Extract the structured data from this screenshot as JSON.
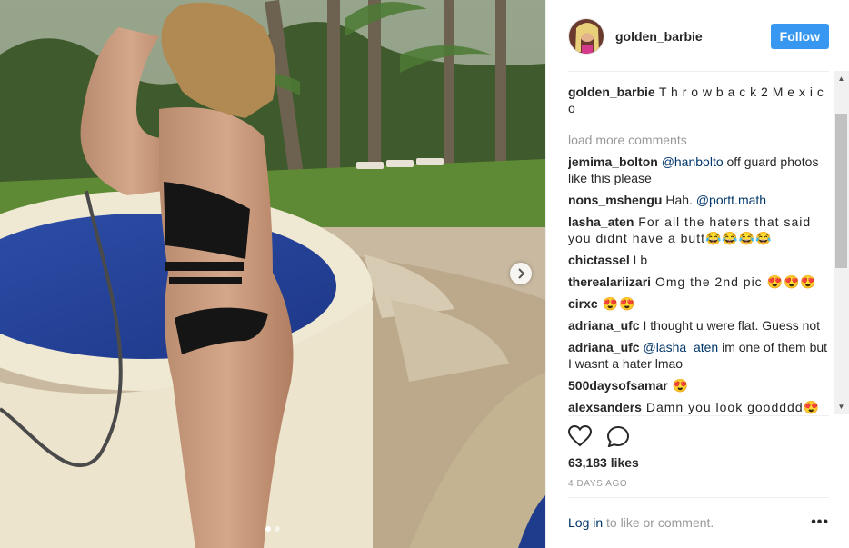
{
  "post": {
    "username": "golden_barbie",
    "follow_label": "Follow",
    "caption_user": "golden_barbie",
    "caption_text": "T h r o w b a c k 2 M e x i c o",
    "load_more": "load more comments",
    "likes": "63,183 likes",
    "time": "4 DAYS AGO",
    "login_link": "Log in",
    "login_rest": " to like or comment.",
    "more": "•••",
    "carousel": {
      "slides": 2,
      "active": 1
    }
  },
  "comments": [
    {
      "user": "jemima_bolton",
      "mention": "@hanbolto",
      "text": " off guard photos like this please"
    },
    {
      "user": "nons_mshengu",
      "text": " Hah. ",
      "mention_after": "@portt.math"
    },
    {
      "user": "lasha_aten",
      "text": " For all the haters that said you didnt have a butt😂😂😂😂"
    },
    {
      "user": "chictassel",
      "text": " Lb"
    },
    {
      "user": "therealariizari",
      "text": " Omg the 2nd pic 😍😍😍"
    },
    {
      "user": "cirxc",
      "text": " 😍😍"
    },
    {
      "user": "adriana_ufc",
      "text": " I thought u were flat. Guess not"
    },
    {
      "user": "adriana_ufc",
      "mention": "@lasha_aten",
      "text": " im one of them but I wasnt a hater lmao"
    },
    {
      "user": "500daysofsamar",
      "text": " 😍"
    },
    {
      "user": "alexsanders",
      "text": " Damn you look goodddd😍😍"
    }
  ],
  "icons": {
    "like": "heart-icon",
    "comment": "comment-bubble-icon",
    "next": "chevron-right-icon"
  },
  "colors": {
    "follow": "#3897f0",
    "link": "#003569",
    "muted": "#999999"
  }
}
